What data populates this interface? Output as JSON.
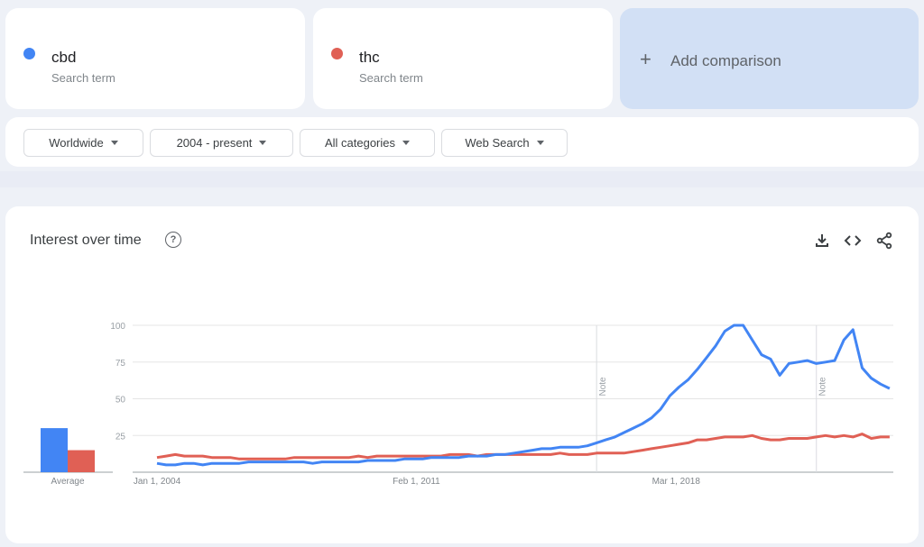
{
  "terms": [
    {
      "name": "cbd",
      "subtitle": "Search term",
      "color": "#4285f4"
    },
    {
      "name": "thc",
      "subtitle": "Search term",
      "color": "#e06055"
    }
  ],
  "add_comparison": {
    "icon": "plus-icon",
    "label": "Add comparison"
  },
  "filters": [
    {
      "label": "Worldwide"
    },
    {
      "label": "2004 - present"
    },
    {
      "label": "All categories"
    },
    {
      "label": "Web Search"
    }
  ],
  "panel": {
    "title": "Interest over time",
    "help_icon": "?",
    "actions": [
      "download-icon",
      "embed-icon",
      "share-icon"
    ]
  },
  "chart_data": {
    "type": "line",
    "title": "Interest over time",
    "ylim": [
      0,
      100
    ],
    "yticks": [
      25,
      50,
      75,
      100
    ],
    "x_tick_labels": [
      "Jan 1, 2004",
      "Feb 1, 2011",
      "Mar 1, 2018"
    ],
    "x_range_years": [
      2004.0,
      2024.1
    ],
    "x_tick_years": [
      2004.0,
      2011.08,
      2018.17
    ],
    "notes": [
      {
        "label": "Note",
        "year": 2016.0
      },
      {
        "label": "Note",
        "year": 2022.0
      }
    ],
    "grid": true,
    "averages": {
      "label": "Average",
      "values": [
        {
          "name": "cbd",
          "value": 30
        },
        {
          "name": "thc",
          "value": 15
        }
      ]
    },
    "x_years": [
      2004.0,
      2004.25,
      2004.5,
      2004.75,
      2005.0,
      2005.25,
      2005.5,
      2005.75,
      2006.0,
      2006.25,
      2006.5,
      2006.75,
      2007.0,
      2007.25,
      2007.5,
      2007.75,
      2008.0,
      2008.25,
      2008.5,
      2008.75,
      2009.0,
      2009.25,
      2009.5,
      2009.75,
      2010.0,
      2010.25,
      2010.5,
      2010.75,
      2011.0,
      2011.25,
      2011.5,
      2011.75,
      2012.0,
      2012.25,
      2012.5,
      2012.75,
      2013.0,
      2013.25,
      2013.5,
      2013.75,
      2014.0,
      2014.25,
      2014.5,
      2014.75,
      2015.0,
      2015.25,
      2015.5,
      2015.75,
      2016.0,
      2016.25,
      2016.5,
      2016.75,
      2017.0,
      2017.25,
      2017.5,
      2017.75,
      2018.0,
      2018.25,
      2018.5,
      2018.75,
      2019.0,
      2019.25,
      2019.5,
      2019.75,
      2020.0,
      2020.25,
      2020.5,
      2020.75,
      2021.0,
      2021.25,
      2021.5,
      2021.75,
      2022.0,
      2022.25,
      2022.5,
      2022.75,
      2023.0,
      2023.25,
      2023.5,
      2023.75,
      2024.0
    ],
    "series": [
      {
        "name": "cbd",
        "color": "#4285f4",
        "values": [
          6,
          5,
          5,
          6,
          6,
          5,
          6,
          6,
          6,
          6,
          7,
          7,
          7,
          7,
          7,
          7,
          7,
          6,
          7,
          7,
          7,
          7,
          7,
          8,
          8,
          8,
          8,
          9,
          9,
          9,
          10,
          10,
          10,
          10,
          11,
          11,
          11,
          12,
          12,
          13,
          14,
          15,
          16,
          16,
          17,
          17,
          17,
          18,
          20,
          22,
          24,
          27,
          30,
          33,
          37,
          43,
          52,
          58,
          63,
          70,
          78,
          86,
          96,
          100,
          100,
          90,
          80,
          77,
          66,
          74,
          75,
          76,
          74,
          75,
          76,
          90,
          97,
          71,
          64,
          60,
          57
        ]
      },
      {
        "name": "thc",
        "color": "#e06055",
        "values": [
          10,
          11,
          12,
          11,
          11,
          11,
          10,
          10,
          10,
          9,
          9,
          9,
          9,
          9,
          9,
          10,
          10,
          10,
          10,
          10,
          10,
          10,
          11,
          10,
          11,
          11,
          11,
          11,
          11,
          11,
          11,
          11,
          12,
          12,
          12,
          11,
          12,
          12,
          12,
          12,
          12,
          12,
          12,
          12,
          13,
          12,
          12,
          12,
          13,
          13,
          13,
          13,
          14,
          15,
          16,
          17,
          18,
          19,
          20,
          22,
          22,
          23,
          24,
          24,
          24,
          25,
          23,
          22,
          22,
          23,
          23,
          23,
          24,
          25,
          24,
          25,
          24,
          26,
          23,
          24,
          24
        ]
      }
    ]
  }
}
